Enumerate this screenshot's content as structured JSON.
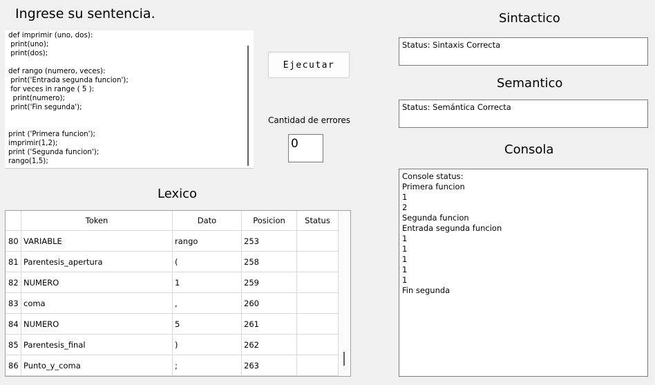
{
  "prompt_title": "Ingrese su sentencia.",
  "code_lines": [
    "def imprimir (uno, dos):",
    " print(uno);",
    " print(dos);",
    "",
    "def rango (numero, veces):",
    " print('Entrada segunda funcion');",
    " for veces in range ( 5 ):",
    "  print(numero);",
    " print('Fin segunda');",
    "",
    "",
    "print ('Primera funcion');",
    "imprimir(1,2);",
    "print ('Segunda funcion');",
    "rango(1,5);"
  ],
  "execute_label": "Ejecutar",
  "errors_label": "Cantidad de errores",
  "errors_value": "0",
  "syntactic": {
    "title": "Sintactico",
    "status": "Status: Sintaxis Correcta"
  },
  "semantic": {
    "title": "Semantico",
    "status": "Status: Semántica Correcta"
  },
  "console": {
    "title": "Consola",
    "lines": [
      "Console status:",
      "Primera funcion",
      "1",
      "2",
      "Segunda funcion",
      "Entrada segunda funcion",
      "1",
      "1",
      "1",
      "1",
      "1",
      "Fin segunda"
    ]
  },
  "lexico": {
    "title": "Lexico",
    "columns": [
      "Token",
      "Dato",
      "Posicion",
      "Status"
    ],
    "rows": [
      {
        "n": "80",
        "token": "VARIABLE",
        "dato": "rango",
        "pos": "253",
        "status": ""
      },
      {
        "n": "81",
        "token": "Parentesis_apertura",
        "dato": "(",
        "pos": "258",
        "status": ""
      },
      {
        "n": "82",
        "token": "NUMERO",
        "dato": "1",
        "pos": "259",
        "status": ""
      },
      {
        "n": "83",
        "token": "coma",
        "dato": ",",
        "pos": "260",
        "status": ""
      },
      {
        "n": "84",
        "token": "NUMERO",
        "dato": "5",
        "pos": "261",
        "status": ""
      },
      {
        "n": "85",
        "token": "Parentesis_final",
        "dato": ")",
        "pos": "262",
        "status": ""
      },
      {
        "n": "86",
        "token": "Punto_y_coma",
        "dato": ";",
        "pos": "263",
        "status": ""
      }
    ]
  }
}
